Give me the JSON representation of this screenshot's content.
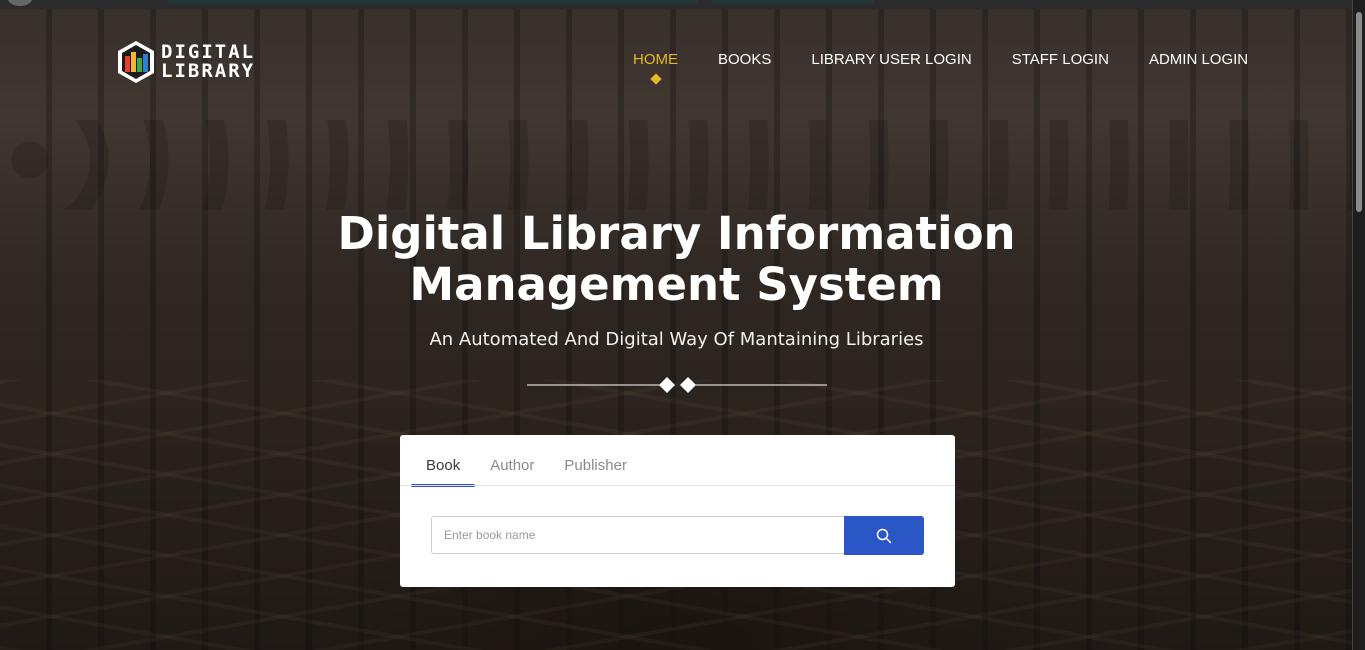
{
  "logo": {
    "line1": "DIGITAL",
    "line2": "LIBRARY"
  },
  "nav": {
    "items": [
      {
        "label": "HOME",
        "active": true
      },
      {
        "label": "BOOKS",
        "active": false
      },
      {
        "label": "LIBRARY USER LOGIN",
        "active": false
      },
      {
        "label": "STAFF LOGIN",
        "active": false
      },
      {
        "label": "ADMIN LOGIN",
        "active": false
      }
    ]
  },
  "hero": {
    "title_line1": "Digital Library Information",
    "title_line2": "Management System",
    "subtitle": "An Automated And Digital Way Of Mantaining Libraries"
  },
  "search": {
    "tabs": [
      {
        "label": "Book",
        "active": true
      },
      {
        "label": "Author",
        "active": false
      },
      {
        "label": "Publisher",
        "active": false
      }
    ],
    "placeholder": "Enter book name",
    "value": "",
    "button_icon": "search-icon"
  },
  "colors": {
    "accent": "#e8b82c",
    "primary": "#2b56c6",
    "text_light": "#ffffff"
  }
}
